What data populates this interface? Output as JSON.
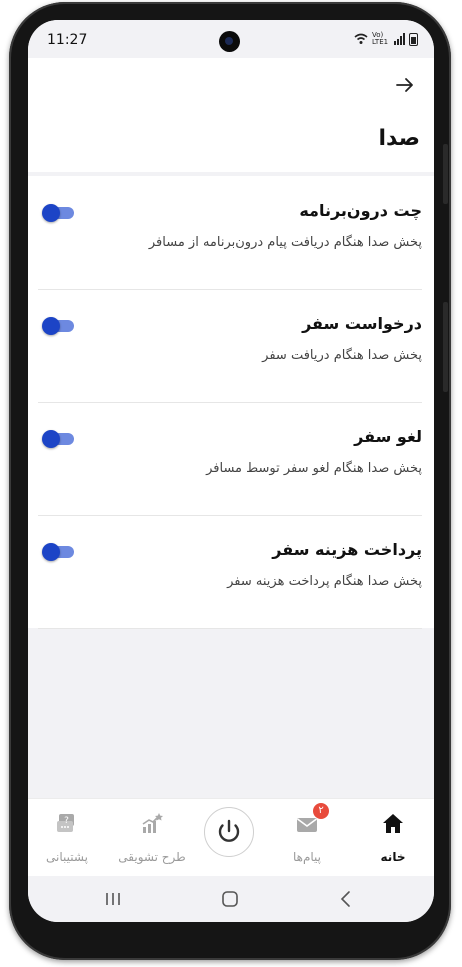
{
  "status_bar": {
    "time": "11:27",
    "network_label": "Vo) LTE1"
  },
  "header": {
    "back_icon": "arrow-right-icon",
    "title": "صدا"
  },
  "settings": [
    {
      "title": "چت درون‌برنامه",
      "subtitle": "پخش صدا هنگام دریافت پیام درون‌برنامه از مسافر",
      "enabled": true
    },
    {
      "title": "درخواست سفر",
      "subtitle": "پخش صدا هنگام دریافت سفر",
      "enabled": true
    },
    {
      "title": "لغو سفر",
      "subtitle": "پخش صدا هنگام لغو سفر توسط مسافر",
      "enabled": true
    },
    {
      "title": "پرداخت هزینه سفر",
      "subtitle": "پخش صدا هنگام پرداخت هزینه سفر",
      "enabled": true
    }
  ],
  "bottom_nav": {
    "home": "خانه",
    "messages": "پیام‌ها",
    "messages_badge": "۲",
    "incentive": "طرح تشویقی",
    "support": "پشتیبانی"
  },
  "colors": {
    "accent": "#1c44c6",
    "toggle_track": "#6d89e0",
    "badge": "#e84b3c"
  }
}
